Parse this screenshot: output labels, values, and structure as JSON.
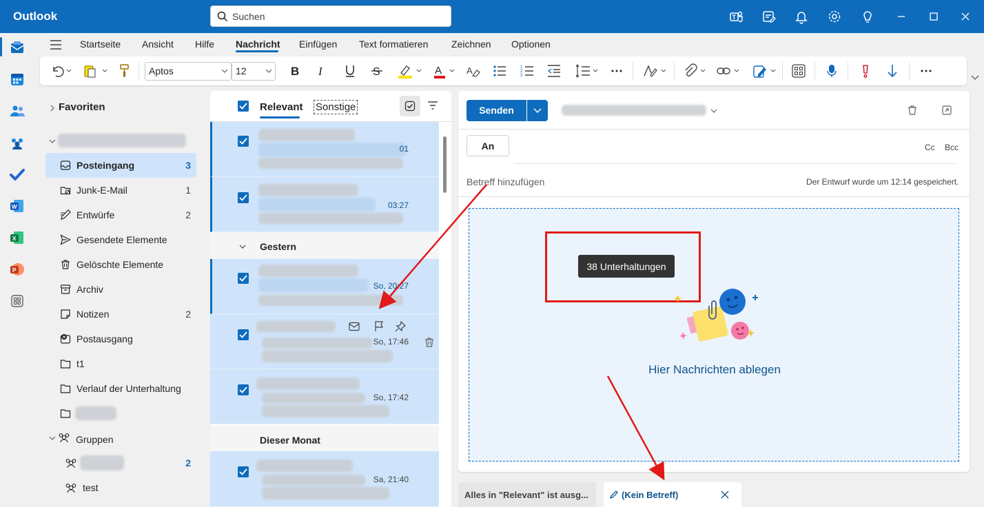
{
  "app": {
    "title": "Outlook"
  },
  "search": {
    "placeholder": "Suchen"
  },
  "ribbon": {
    "tabs": [
      "Startseite",
      "Ansicht",
      "Hilfe",
      "Nachricht",
      "Einfügen",
      "Text formatieren",
      "Zeichnen",
      "Optionen"
    ],
    "active_tab": "Nachricht",
    "font_name": "Aptos",
    "font_size": "12"
  },
  "folders": {
    "favorites_label": "Favoriten",
    "items": [
      {
        "label": "Posteingang",
        "count": "3",
        "icon": "inbox-icon"
      },
      {
        "label": "Junk-E-Mail",
        "count": "1",
        "icon": "junk-icon"
      },
      {
        "label": "Entwürfe",
        "count": "2",
        "icon": "drafts-icon"
      },
      {
        "label": "Gesendete Elemente",
        "count": "",
        "icon": "sent-icon"
      },
      {
        "label": "Gelöschte Elemente",
        "count": "",
        "icon": "trash-icon"
      },
      {
        "label": "Archiv",
        "count": "",
        "icon": "archive-icon"
      },
      {
        "label": "Notizen",
        "count": "2",
        "icon": "notes-icon"
      },
      {
        "label": "Postausgang",
        "count": "",
        "icon": "outbox-icon"
      },
      {
        "label": "t1",
        "count": "",
        "icon": "folder-icon"
      },
      {
        "label": "Verlauf der Unterhaltung",
        "count": "",
        "icon": "folder-icon"
      }
    ],
    "groups_label": "Gruppen",
    "group_items": [
      {
        "label": "",
        "count": "2"
      },
      {
        "label": "test",
        "count": ""
      }
    ]
  },
  "message_list": {
    "tab_focused": "Relevant",
    "tab_other": "Sonstige",
    "groups": [
      "Gestern",
      "Dieser Monat"
    ],
    "rows": [
      {
        "time": "01"
      },
      {
        "time": "03:27"
      },
      {
        "time": "So, 20:27"
      },
      {
        "time": "So, 17:46"
      },
      {
        "time": "So, 17:42"
      },
      {
        "time": "Sa, 21:40"
      }
    ]
  },
  "compose": {
    "send_label": "Senden",
    "to_label": "An",
    "cc_label": "Cc",
    "bcc_label": "Bcc",
    "subject_placeholder": "Betreff hinzufügen",
    "draft_saved": "Der Entwurf wurde um 12:14 gespeichert.",
    "drag_tooltip": "38 Unterhaltungen",
    "drop_text": "Hier Nachrichten ablegen"
  },
  "bottom_tabs": {
    "tab1": "Alles in \"Relevant\" ist ausg...",
    "tab2": "(Kein Betreff)"
  },
  "colors": {
    "accent": "#0f6cbd",
    "annotation": "#e11919",
    "selection": "#cfe4fa"
  }
}
